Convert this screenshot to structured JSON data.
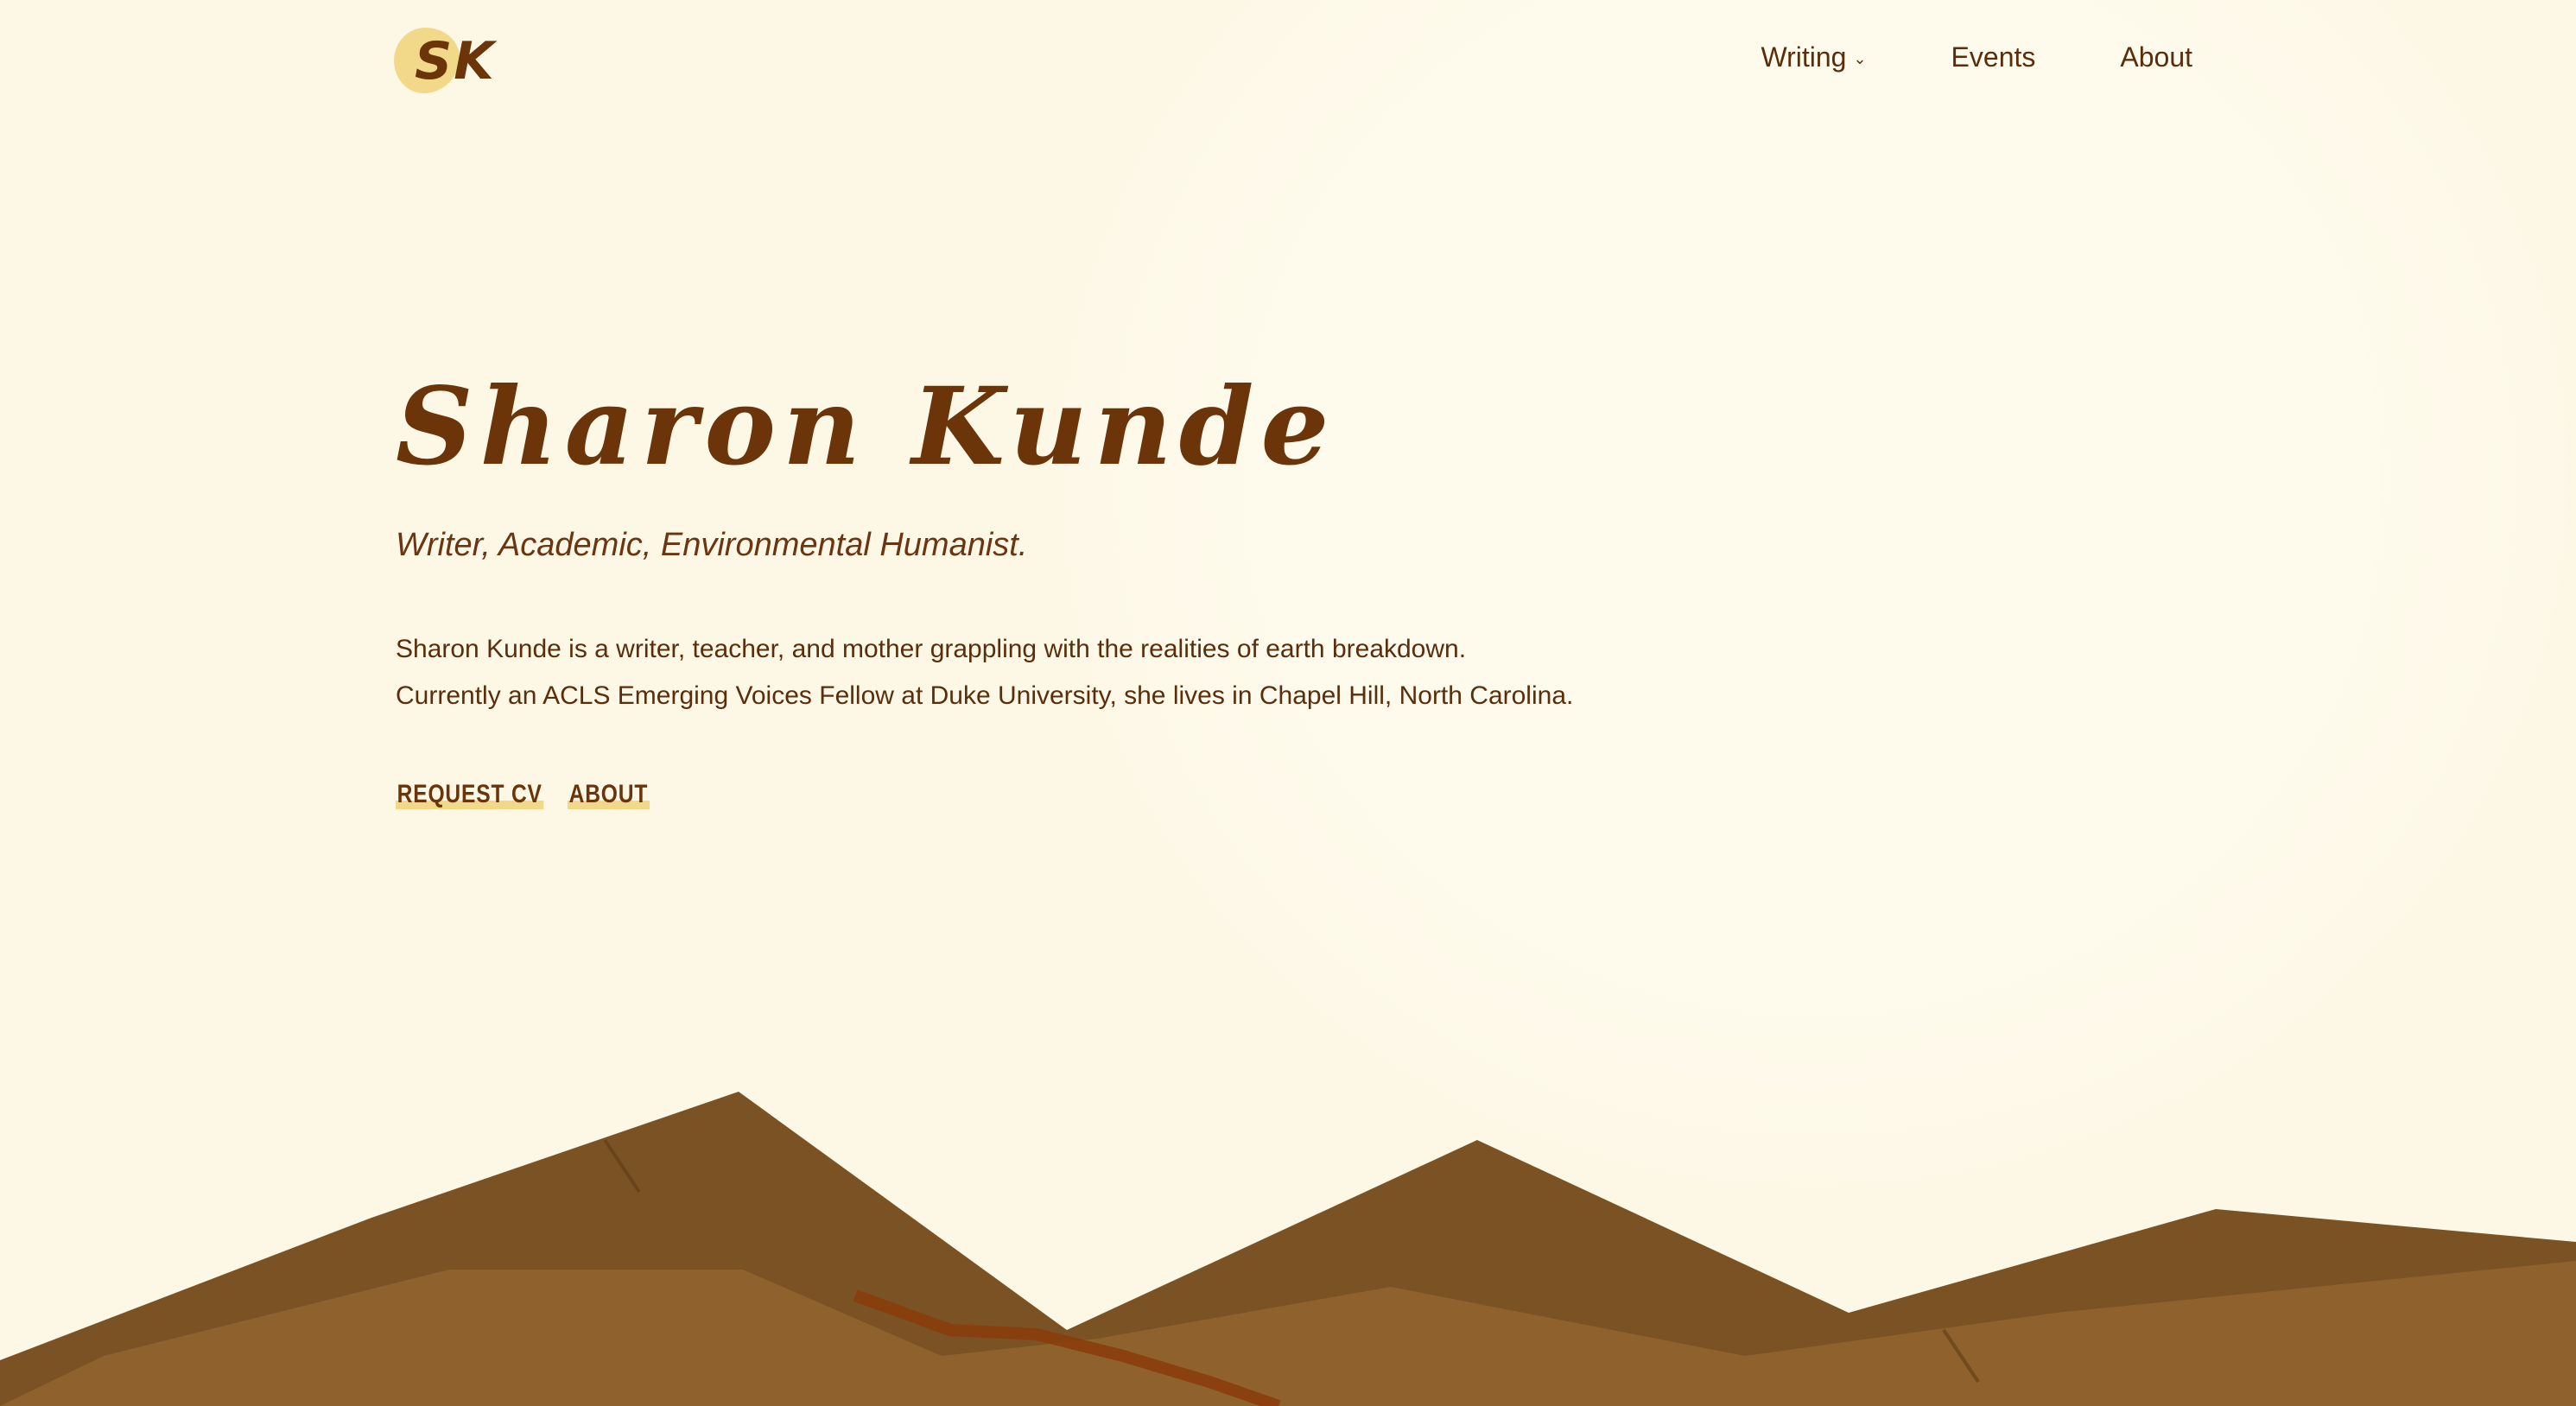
{
  "brand": {
    "logo_text": "SK"
  },
  "nav": {
    "items": [
      {
        "label": "Writing",
        "has_dropdown": true,
        "icon": "chevron-down-icon"
      },
      {
        "label": "Events"
      },
      {
        "label": "About"
      }
    ]
  },
  "hero": {
    "name": "Sharon Kunde",
    "tagline": "Writer, Academic, Environmental Humanist.",
    "bio_line1": "Sharon Kunde is a writer, teacher, and mother grappling with the realities of earth breakdown.",
    "bio_line2": "Currently an ACLS Emerging Voices Fellow at Duke University, she lives in Chapel Hill, North Carolina.",
    "links": [
      {
        "label": "REQUEST CV"
      },
      {
        "label": "ABOUT"
      }
    ]
  },
  "colors": {
    "background": "#fdf8e6",
    "text": "#5a2e0c",
    "accent": "#f2d98a",
    "mountain_dark": "#7a5224",
    "mountain_light": "#9a6a30",
    "crack": "#8a3d0c"
  }
}
